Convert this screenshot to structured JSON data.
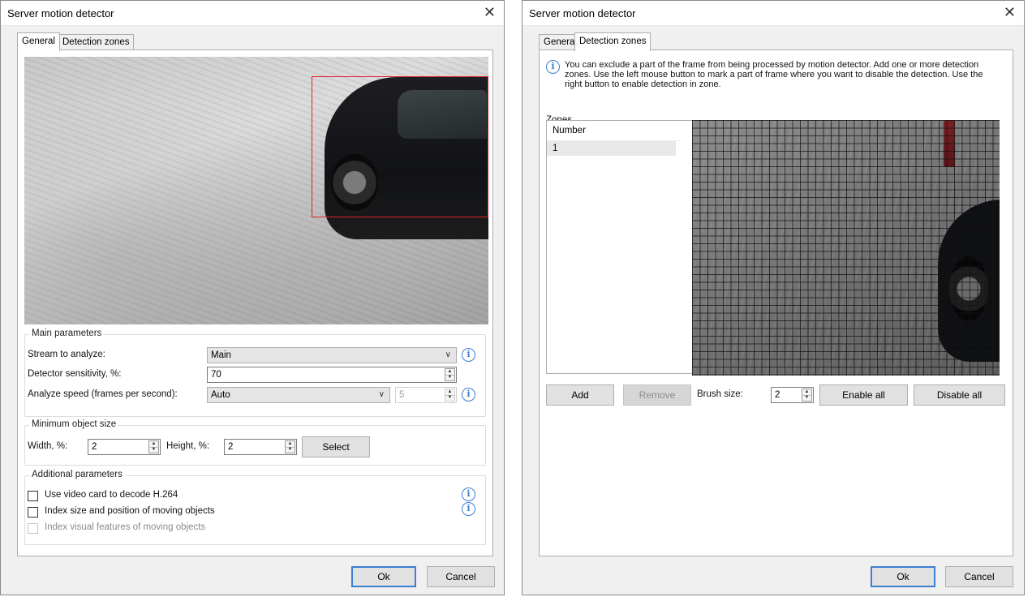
{
  "dialog1": {
    "title": "Server motion detector",
    "tabs": [
      "General",
      "Detection zones"
    ],
    "active_tab": "General",
    "main_parameters": {
      "title": "Main parameters",
      "stream_label": "Stream to analyze:",
      "stream_value": "Main",
      "sensitivity_label": "Detector sensitivity, %:",
      "sensitivity_value": "70",
      "speed_label": "Analyze speed (frames per second):",
      "speed_value": "Auto",
      "speed_fps_value": "5"
    },
    "min_object_size": {
      "title": "Minimum object size",
      "width_label": "Width, %:",
      "width_value": "2",
      "height_label": "Height, %:",
      "height_value": "2",
      "select_label": "Select"
    },
    "additional": {
      "title": "Additional parameters",
      "decode_label": "Use video card to decode H.264",
      "index_size_label": "Index size and position of moving objects",
      "index_visual_label": "Index visual features of moving objects"
    },
    "ok_label": "Ok",
    "cancel_label": "Cancel"
  },
  "dialog2": {
    "title": "Server motion detector",
    "tabs": [
      "General",
      "Detection zones"
    ],
    "active_tab": "Detection zones",
    "info_line1": "You can exclude a part of the frame from being processed by motion detector. Add one or more detection",
    "info_line2": "zones. Use the left mouse button to mark a part of frame where you want to disable the detection. Use the",
    "info_line3": "right button to enable detection in zone.",
    "zones_label": "Zones",
    "list_header": "Number",
    "list_items": [
      "1"
    ],
    "add_label": "Add",
    "remove_label": "Remove",
    "brush_label": "Brush size:",
    "brush_value": "2",
    "enable_all_label": "Enable all",
    "disable_all_label": "Disable all",
    "ok_label": "Ok",
    "cancel_label": "Cancel"
  },
  "colors": {
    "accent": "#3c7ed1",
    "zone_border": "#e0242c",
    "dialog_bg": "#f0f0f0"
  },
  "icons": {
    "close": "close-icon",
    "info": "info-icon",
    "dropdown": "chevron-down-icon"
  }
}
